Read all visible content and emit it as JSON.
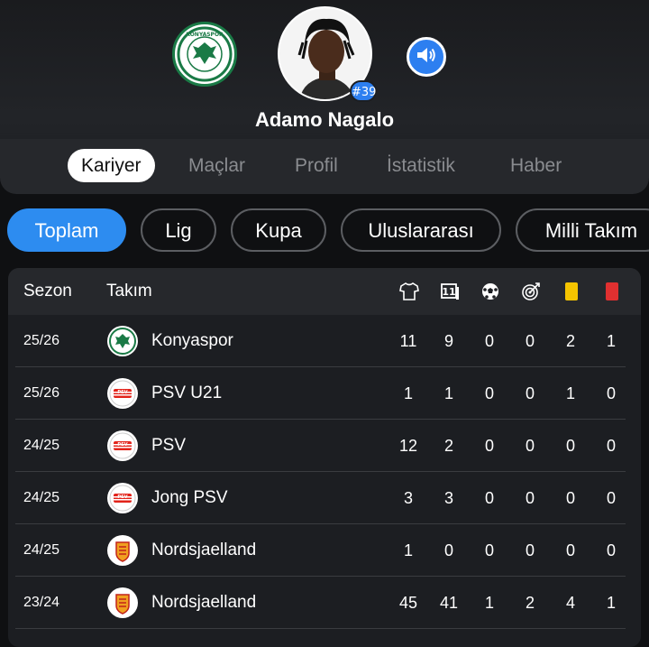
{
  "player": {
    "name": "Adamo Nagalo",
    "jersey": "#39",
    "team_logo_icon": "konyaspor-crest-icon",
    "sound_icon": "speaker-icon"
  },
  "tabs": [
    {
      "label": "Kariyer",
      "active": true
    },
    {
      "label": "Maçlar",
      "active": false
    },
    {
      "label": "Profil",
      "active": false
    },
    {
      "label": "İstatistik",
      "active": false
    },
    {
      "label": "Haber",
      "active": false
    }
  ],
  "filters": [
    {
      "label": "Toplam",
      "active": true
    },
    {
      "label": "Lig",
      "active": false
    },
    {
      "label": "Kupa",
      "active": false
    },
    {
      "label": "Uluslararası",
      "active": false
    },
    {
      "label": "Milli Takım",
      "active": false
    }
  ],
  "table": {
    "headers": {
      "season": "Sezon",
      "team": "Takım",
      "icons": [
        "jersey-icon",
        "substitution-icon",
        "ball-icon",
        "target-icon",
        "yellow-card-icon",
        "red-card-icon"
      ]
    },
    "colors": {
      "accent": "#2d8cf0",
      "yellow": "#f5c400",
      "red": "#e03030"
    },
    "rows": [
      {
        "season": "25/26",
        "club": "Konyaspor",
        "crest": "konyaspor",
        "stats": [
          "11",
          "9",
          "0",
          "0",
          "2",
          "1"
        ]
      },
      {
        "season": "25/26",
        "club": "PSV U21",
        "crest": "psv",
        "stats": [
          "1",
          "1",
          "0",
          "0",
          "1",
          "0"
        ]
      },
      {
        "season": "24/25",
        "club": "PSV",
        "crest": "psv",
        "stats": [
          "12",
          "2",
          "0",
          "0",
          "0",
          "0"
        ]
      },
      {
        "season": "24/25",
        "club": "Jong PSV",
        "crest": "psv",
        "stats": [
          "3",
          "3",
          "0",
          "0",
          "0",
          "0"
        ]
      },
      {
        "season": "24/25",
        "club": "Nordsjaelland",
        "crest": "nordsjaelland",
        "stats": [
          "1",
          "0",
          "0",
          "0",
          "0",
          "0"
        ]
      },
      {
        "season": "23/24",
        "club": "Nordsjaelland",
        "crest": "nordsjaelland",
        "stats": [
          "45",
          "41",
          "1",
          "2",
          "4",
          "1"
        ]
      }
    ]
  }
}
